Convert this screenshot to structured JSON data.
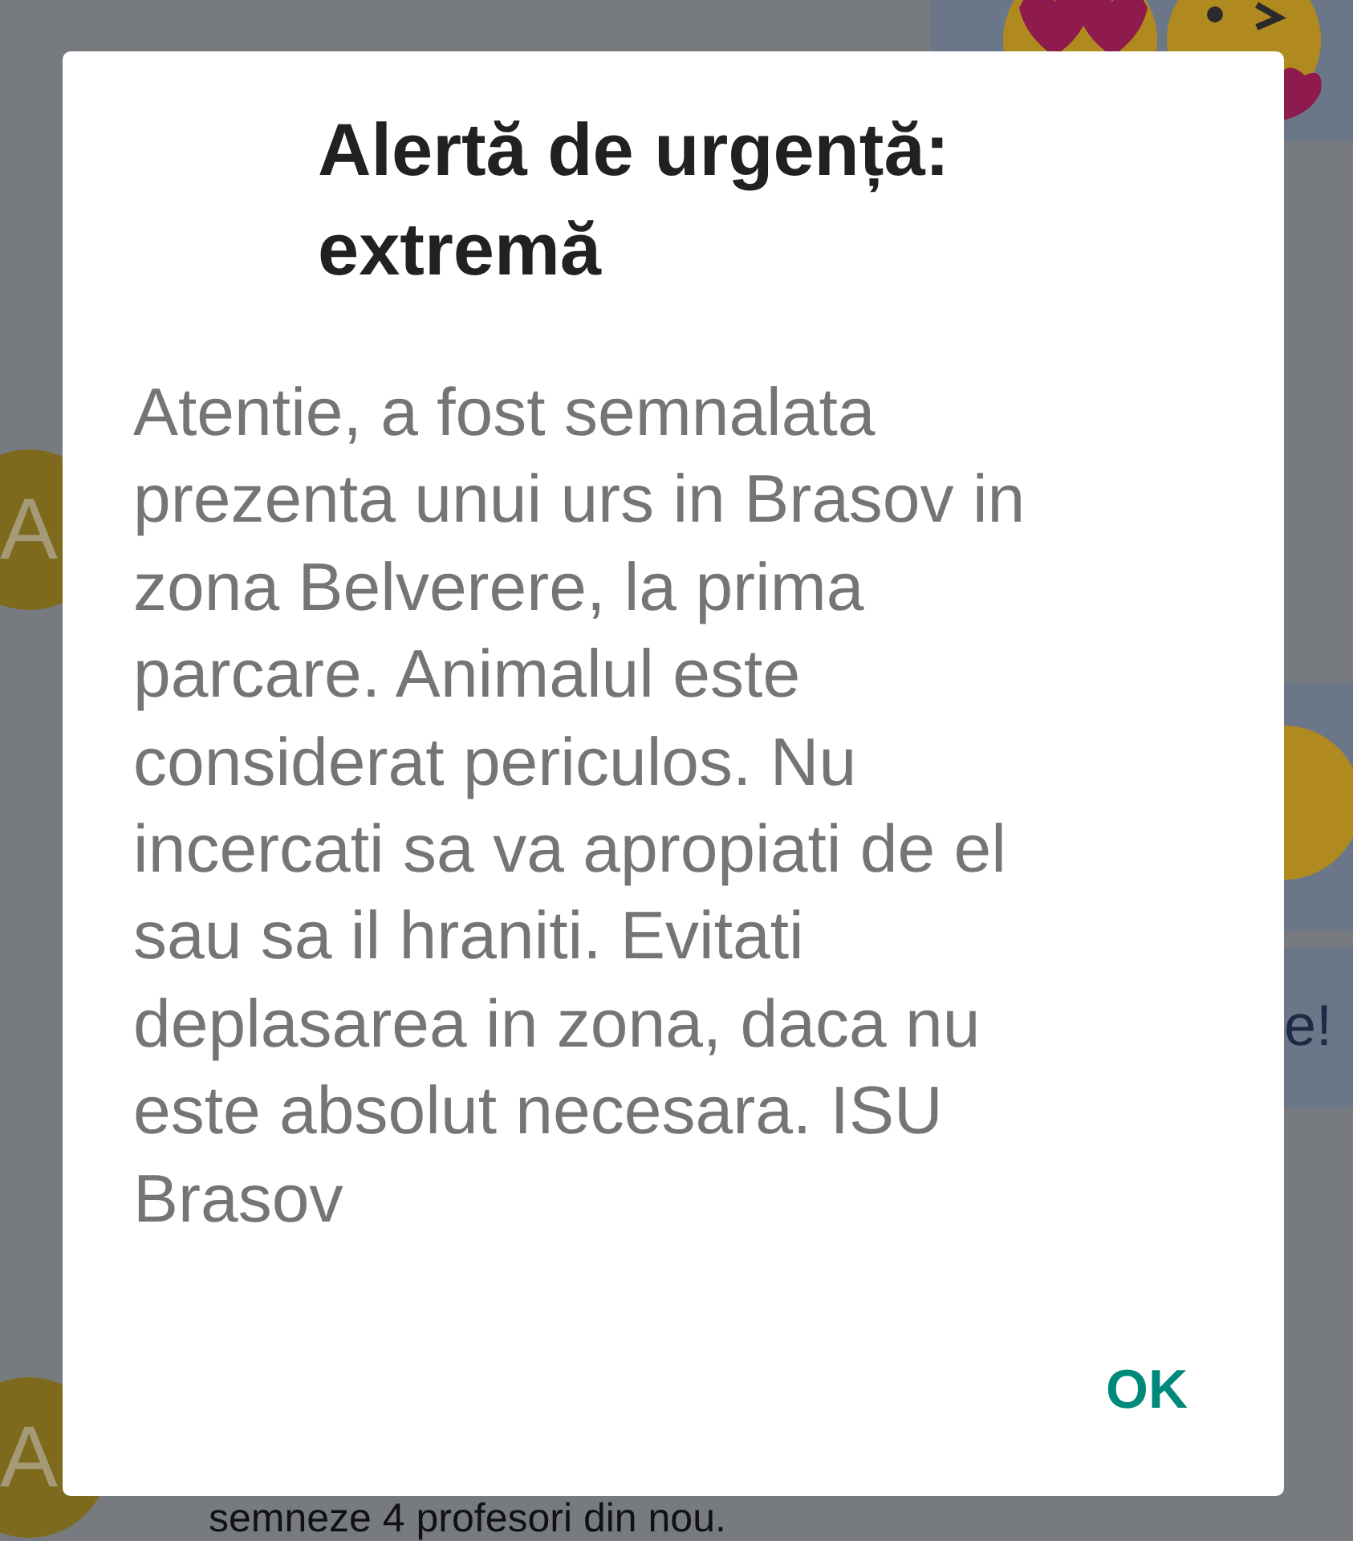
{
  "backdrop": {
    "avatars": [
      {
        "letter": "A"
      },
      {
        "letter": "A"
      }
    ],
    "bubble_text": "e!",
    "message_text": "semneze 4 profesori din nou."
  },
  "dialog": {
    "title": "Alertă de urgență: extremă",
    "body": "Atentie, a fost semnalata prezenta unui urs in Brasov in zona Belverere, la prima parcare. Animalul este considerat periculos. Nu incercati sa va apropiati de el sau sa il hraniti. Evitati deplasarea in zona, daca nu este absolut necesara. ISU Brasov",
    "button": "OK"
  }
}
